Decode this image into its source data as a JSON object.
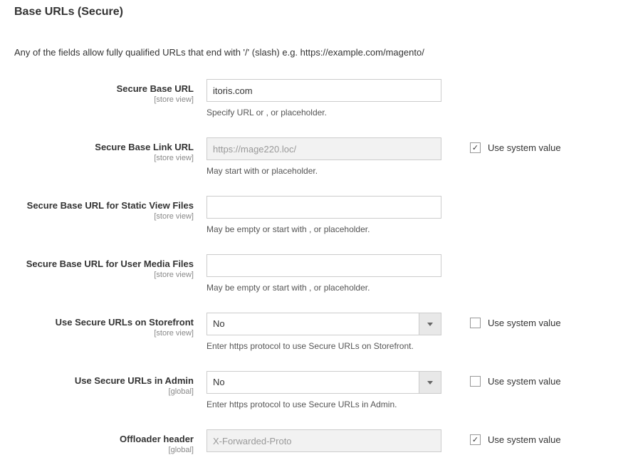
{
  "section": {
    "title": "Base URLs (Secure)",
    "description": "Any of the fields allow fully qualified URLs that end with '/' (slash) e.g. https://example.com/magento/"
  },
  "fields": {
    "secure_base_url": {
      "label": "Secure Base URL",
      "scope": "[store view]",
      "value": "itoris.com",
      "hint": "Specify URL or , or placeholder."
    },
    "secure_base_link_url": {
      "label": "Secure Base Link URL",
      "scope": "[store view]",
      "value": "https://mage220.loc/",
      "hint": "May start with or placeholder.",
      "sysval_label": "Use system value",
      "sysval_checked": "✓"
    },
    "secure_base_static": {
      "label": "Secure Base URL for Static View Files",
      "scope": "[store view]",
      "value": "",
      "hint": "May be empty or start with , or placeholder."
    },
    "secure_base_media": {
      "label": "Secure Base URL for User Media Files",
      "scope": "[store view]",
      "value": "",
      "hint": "May be empty or start with , or placeholder."
    },
    "use_secure_storefront": {
      "label": "Use Secure URLs on Storefront",
      "scope": "[store view]",
      "value": "No",
      "hint": "Enter https protocol to use Secure URLs on Storefront.",
      "sysval_label": "Use system value",
      "sysval_checked": ""
    },
    "use_secure_admin": {
      "label": "Use Secure URLs in Admin",
      "scope": "[global]",
      "value": "No",
      "hint": "Enter https protocol to use Secure URLs in Admin.",
      "sysval_label": "Use system value",
      "sysval_checked": ""
    },
    "offloader_header": {
      "label": "Offloader header",
      "scope": "[global]",
      "value": "X-Forwarded-Proto",
      "sysval_label": "Use system value",
      "sysval_checked": "✓"
    }
  }
}
